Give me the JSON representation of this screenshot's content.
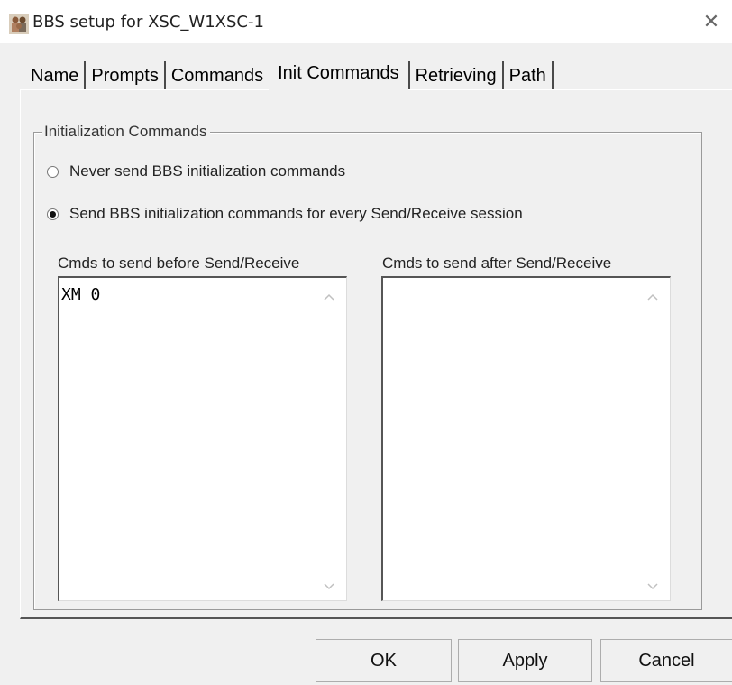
{
  "window": {
    "title": "BBS setup for XSC_W1XSC-1",
    "close_glyph": "✕"
  },
  "tabs": [
    {
      "label": "Name",
      "active": false
    },
    {
      "label": "Prompts",
      "active": false
    },
    {
      "label": "Commands",
      "active": false
    },
    {
      "label": "Init Commands",
      "active": true
    },
    {
      "label": "Retrieving",
      "active": false
    },
    {
      "label": "Path",
      "active": false
    }
  ],
  "group": {
    "legend": "Initialization Commands",
    "options": [
      {
        "label": "Never send BBS initialization commands",
        "checked": false
      },
      {
        "label": "Send BBS initialization commands for every Send/Receive session",
        "checked": true
      }
    ]
  },
  "lists": {
    "before": {
      "label": "Cmds to send before Send/Receive",
      "value": "XM 0"
    },
    "after": {
      "label": "Cmds to send after Send/Receive",
      "value": ""
    }
  },
  "buttons": {
    "ok": "OK",
    "apply": "Apply",
    "cancel": "Cancel"
  },
  "icons": {
    "app": "bbs-people-icon",
    "close": "close-icon",
    "scroll_up": "chevron-up-icon",
    "scroll_down": "chevron-down-icon"
  }
}
